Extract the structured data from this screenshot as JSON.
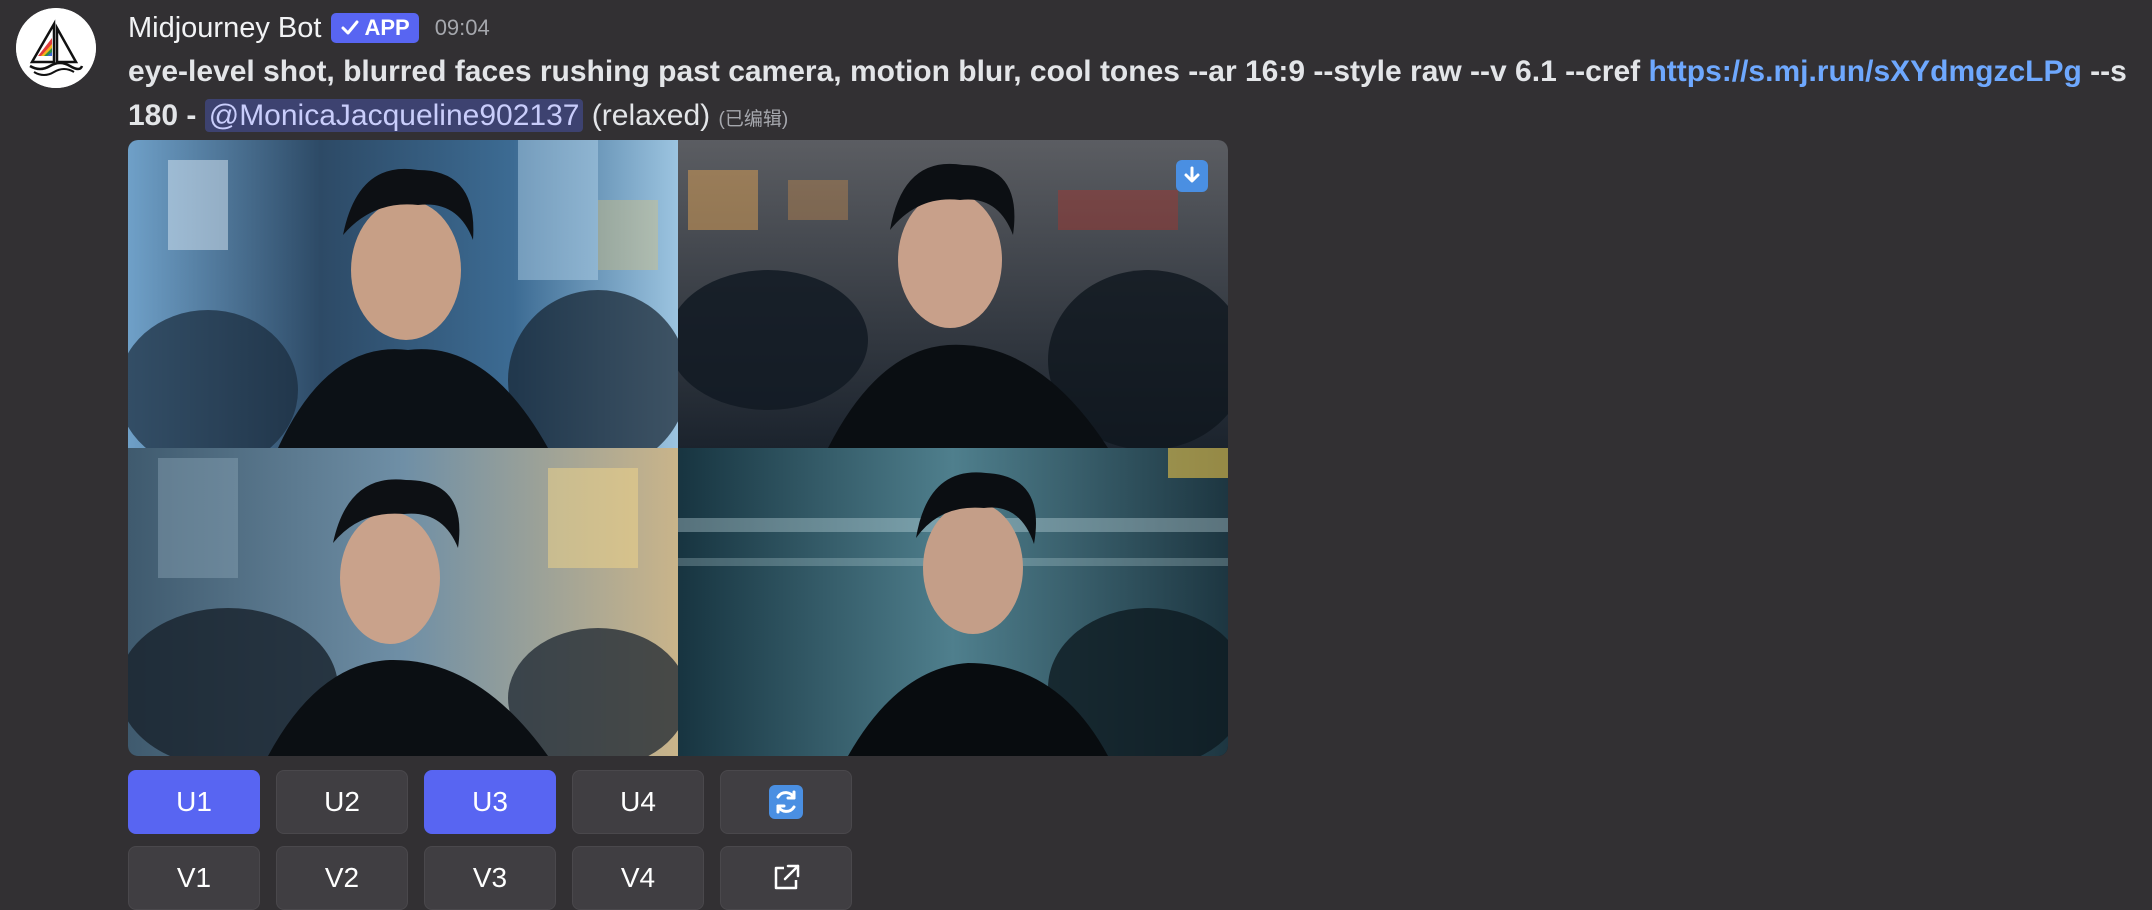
{
  "message": {
    "author": "Midjourney Bot",
    "badge": "APP",
    "timestamp": "09:04",
    "prompt_text": "eye-level shot, blurred faces rushing past camera, motion blur, cool tones --ar 16:9 --style raw --v 6.1 --cref ",
    "cref_link": "https://s.mj.run/sXYdmgzcLPg",
    "prompt_suffix": " --s 180",
    "separator": " - ",
    "mention": "@MonicaJacqueline902137",
    "mode": " (relaxed) ",
    "edited": "(已编辑)"
  },
  "image_grid": {
    "panels": [
      "panel-1",
      "panel-2",
      "panel-3",
      "panel-4"
    ],
    "download_icon": "download-arrow-icon"
  },
  "buttons": {
    "row1": [
      {
        "label": "U1",
        "active": true
      },
      {
        "label": "U2",
        "active": false
      },
      {
        "label": "U3",
        "active": true
      },
      {
        "label": "U4",
        "active": false
      }
    ],
    "reroll_icon": "refresh-icon",
    "row2": [
      {
        "label": "V1"
      },
      {
        "label": "V2"
      },
      {
        "label": "V3"
      },
      {
        "label": "V4"
      }
    ],
    "web_icon": "external-link-icon"
  },
  "colors": {
    "background": "#323033",
    "accent": "#5865f2",
    "link": "#6ea8fe",
    "button": "#403e42"
  }
}
